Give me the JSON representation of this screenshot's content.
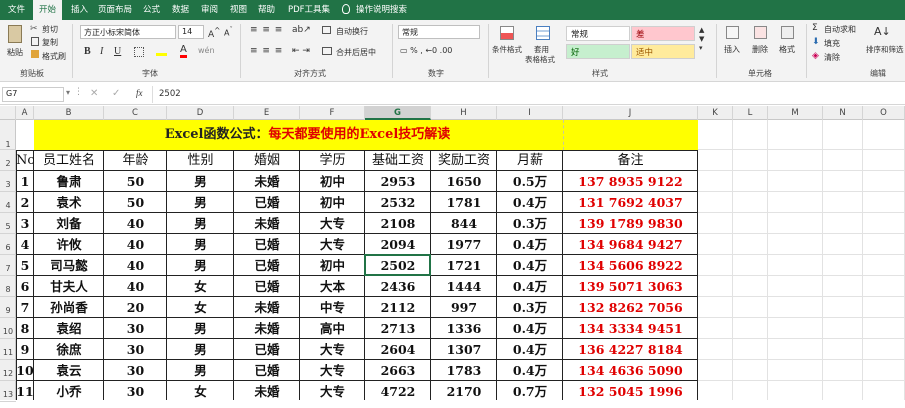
{
  "menu": {
    "tabs": [
      "文件",
      "开始",
      "插入",
      "页面布局",
      "公式",
      "数据",
      "审阅",
      "视图",
      "帮助",
      "PDF工具集"
    ],
    "search": "操作说明搜索"
  },
  "ribbon": {
    "paste": "粘贴",
    "cut": "剪切",
    "copy": "复制",
    "format_painter": "格式刷",
    "clipboard_label": "剪贴板",
    "font_name": "方正小标宋简体",
    "font_size": "14",
    "font_label": "字体",
    "wrap_text": "自动换行",
    "merge_center": "合并后居中",
    "alignment_label": "对齐方式",
    "number_format": "常规",
    "number_label": "数字",
    "conditional_format": "条件格式",
    "format_as_table": "套用\n表格格式",
    "cell_styles": "单元格样式",
    "style_normal": "常规",
    "style_bad": "差",
    "style_good": "好",
    "style_neutral": "适中",
    "styles_label": "样式",
    "insert": "插入",
    "delete": "删除",
    "format": "格式",
    "cells_label": "单元格",
    "autosum": "自动求和",
    "fill": "填充",
    "clear": "清除",
    "sort_filter": "排序和筛选",
    "editing_label": "编辑"
  },
  "formula_bar": {
    "name_box": "G7",
    "fx": "fx",
    "value": "2502"
  },
  "columns": [
    "A",
    "B",
    "C",
    "D",
    "E",
    "F",
    "G",
    "H",
    "I",
    "J",
    "K",
    "L",
    "M",
    "N",
    "O"
  ],
  "rows": [
    "1",
    "2",
    "3",
    "4",
    "5",
    "6",
    "7",
    "8",
    "9",
    "10",
    "11",
    "12",
    "13"
  ],
  "sheet": {
    "title_black": "Excel函数公式：",
    "title_red": "每天都要使用的Excel技巧解读",
    "headers": [
      "No",
      "员工姓名",
      "年龄",
      "性别",
      "婚姻",
      "学历",
      "基础工资",
      "奖励工资",
      "月薪",
      "备注"
    ],
    "records": [
      [
        "1",
        "鲁肃",
        "50",
        "男",
        "未婚",
        "初中",
        "2953",
        "1650",
        "0.5万",
        "137  8935  9122"
      ],
      [
        "2",
        "袁术",
        "50",
        "男",
        "已婚",
        "初中",
        "2532",
        "1781",
        "0.4万",
        "131  7692  4037"
      ],
      [
        "3",
        "刘备",
        "40",
        "男",
        "未婚",
        "大专",
        "2108",
        "844",
        "0.3万",
        "139  1789  9830"
      ],
      [
        "4",
        "许攸",
        "40",
        "男",
        "已婚",
        "大专",
        "2094",
        "1977",
        "0.4万",
        "134  9684  9427"
      ],
      [
        "5",
        "司马懿",
        "40",
        "男",
        "已婚",
        "初中",
        "2502",
        "1721",
        "0.4万",
        "134  5606  8922"
      ],
      [
        "6",
        "甘夫人",
        "40",
        "女",
        "已婚",
        "大本",
        "2436",
        "1444",
        "0.4万",
        "139  5071  3063"
      ],
      [
        "7",
        "孙尚香",
        "20",
        "女",
        "未婚",
        "中专",
        "2112",
        "997",
        "0.3万",
        "132  8262  7056"
      ],
      [
        "8",
        "袁绍",
        "30",
        "男",
        "未婚",
        "高中",
        "2713",
        "1336",
        "0.4万",
        "134  3334  9451"
      ],
      [
        "9",
        "徐庶",
        "30",
        "男",
        "已婚",
        "大专",
        "2604",
        "1307",
        "0.4万",
        "136  4227  8184"
      ],
      [
        "10",
        "袁云",
        "30",
        "男",
        "已婚",
        "大专",
        "2663",
        "1783",
        "0.4万",
        "134  4636  5090"
      ],
      [
        "11",
        "小乔",
        "30",
        "女",
        "未婚",
        "大专",
        "4722",
        "2170",
        "0.7万",
        "132  5045  1996"
      ]
    ]
  },
  "colors": {
    "excel_green": "#217346",
    "title_fill": "#ffff00",
    "remark_red": "#e00000",
    "style_bad_bg": "#ffc7ce",
    "style_good_bg": "#c6efce",
    "style_neutral_bg": "#ffeb9c"
  }
}
